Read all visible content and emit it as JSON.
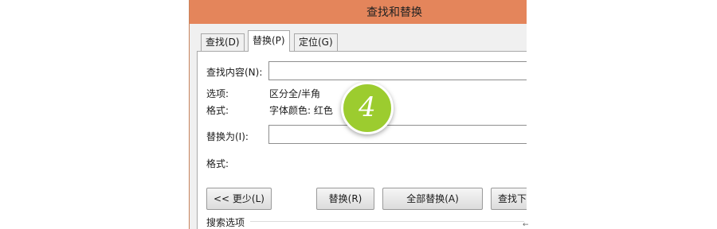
{
  "dialog": {
    "title": "查找和替换"
  },
  "tabs": [
    {
      "label": "查找(D)"
    },
    {
      "label": "替换(P)"
    },
    {
      "label": "定位(G)"
    }
  ],
  "find": {
    "label": "查找内容(N):",
    "value": ""
  },
  "options": {
    "label": "选项:",
    "value": "区分全/半角",
    "format_label": "格式:",
    "format_value": "字体颜色: 红色"
  },
  "replace": {
    "label": "替换为(I):",
    "value": "",
    "format_label": "格式:"
  },
  "buttons": {
    "less": "<< 更少(L)",
    "replace": "替换(R)",
    "replace_all": "全部替换(A)",
    "find_next": "查找下"
  },
  "search_options_label": "搜索选项",
  "step_badge": "4",
  "colors": {
    "titlebar": "#e4855b",
    "badge": "#9ccc2f"
  }
}
